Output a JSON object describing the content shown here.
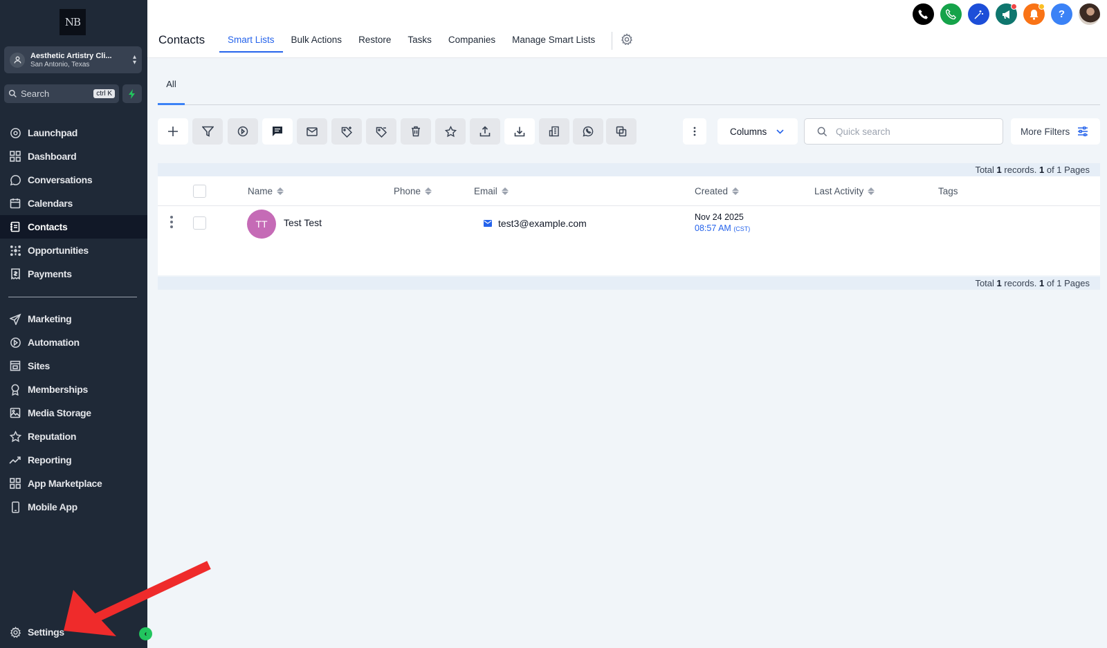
{
  "colors": {
    "sidebar_bg": "#1f2937",
    "accent": "#2563eb",
    "avatar_bg": "#c56bb6",
    "annotation_arrow": "#ef2b2b"
  },
  "sidebar": {
    "logo_text": "NB",
    "account": {
      "name": "Aesthetic Artistry Cli...",
      "location": "San Antonio, Texas"
    },
    "search": {
      "placeholder": "Search",
      "shortcut": "ctrl K"
    },
    "items": [
      {
        "label": "Launchpad",
        "icon": "launchpad-icon"
      },
      {
        "label": "Dashboard",
        "icon": "dashboard-icon"
      },
      {
        "label": "Conversations",
        "icon": "chat-icon"
      },
      {
        "label": "Calendars",
        "icon": "calendar-icon"
      },
      {
        "label": "Contacts",
        "icon": "contacts-icon",
        "active": true
      },
      {
        "label": "Opportunities",
        "icon": "opportunities-icon"
      },
      {
        "label": "Payments",
        "icon": "payments-icon"
      }
    ],
    "items2": [
      {
        "label": "Marketing",
        "icon": "send-icon"
      },
      {
        "label": "Automation",
        "icon": "automation-icon"
      },
      {
        "label": "Sites",
        "icon": "sites-icon"
      },
      {
        "label": "Memberships",
        "icon": "award-icon"
      },
      {
        "label": "Media Storage",
        "icon": "image-icon"
      },
      {
        "label": "Reputation",
        "icon": "star-icon"
      },
      {
        "label": "Reporting",
        "icon": "trend-icon"
      },
      {
        "label": "App Marketplace",
        "icon": "grid-icon"
      },
      {
        "label": "Mobile App",
        "icon": "mobile-icon"
      }
    ],
    "settings_label": "Settings"
  },
  "header": {
    "title": "Contacts",
    "tabs": [
      {
        "label": "Smart Lists",
        "active": true
      },
      {
        "label": "Bulk Actions"
      },
      {
        "label": "Restore"
      },
      {
        "label": "Tasks"
      },
      {
        "label": "Companies"
      },
      {
        "label": "Manage Smart Lists"
      }
    ],
    "top_icons": [
      "phone-icon",
      "call-icon",
      "magic-icon",
      "megaphone-icon",
      "bell-icon",
      "help-icon",
      "user-avatar"
    ]
  },
  "subtabs": {
    "all_label": "All"
  },
  "toolbar": {
    "buttons": [
      "add-icon",
      "filter-icon",
      "workflow-icon",
      "message-icon",
      "mail-icon",
      "tag-add-icon",
      "tag-remove-icon",
      "trash-icon",
      "star-icon",
      "export-icon",
      "import-icon",
      "company-icon",
      "whatsapp-icon",
      "merge-icon"
    ],
    "columns_label": "Columns",
    "quick_search_placeholder": "Quick search",
    "more_filters_label": "More Filters"
  },
  "records": {
    "prefix": "Total",
    "count": "1",
    "mid": "records.",
    "page": "1",
    "of_pages": "of 1 Pages"
  },
  "table": {
    "columns": [
      "Name",
      "Phone",
      "Email",
      "Created",
      "Last Activity",
      "Tags"
    ],
    "rows": [
      {
        "initials": "TT",
        "name": "Test Test",
        "phone": "",
        "email": "test3@example.com",
        "created_date": "Nov 24 2025",
        "created_time": "08:57 AM",
        "created_tz": "(CST)"
      }
    ]
  }
}
